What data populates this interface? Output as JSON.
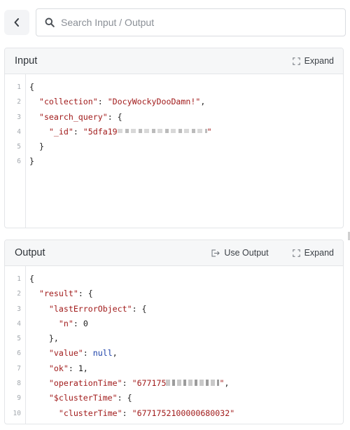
{
  "search": {
    "placeholder": "Search Input / Output"
  },
  "input_panel": {
    "title": "Input",
    "expand_label": "Expand",
    "line_numbers": [
      "1",
      "2",
      "3",
      "4",
      "5",
      "6"
    ],
    "code": {
      "collection_key": "\"collection\"",
      "collection_value": "\"DocyWockyDooDamn!\"",
      "search_query_key": "\"search_query\"",
      "id_key": "\"_id\"",
      "id_value_start": "\"5dfa19",
      "id_value_end": "\""
    }
  },
  "output_panel": {
    "title": "Output",
    "use_output_label": "Use Output",
    "expand_label": "Expand",
    "line_numbers": [
      "1",
      "2",
      "3",
      "4",
      "5",
      "6",
      "7",
      "8",
      "9",
      "10"
    ],
    "code": {
      "result_key": "\"result\"",
      "last_error_key": "\"lastErrorObject\"",
      "n_key": "\"n\"",
      "n_value": "0",
      "value_key": "\"value\"",
      "value_value": "null",
      "ok_key": "\"ok\"",
      "ok_value": "1",
      "op_time_key": "\"operationTime\"",
      "op_time_value_start": "\"677175",
      "op_time_value_end": "\"",
      "cluster_time_key": "\"$clusterTime\"",
      "cluster_time_inner_key": "\"clusterTime\"",
      "cluster_time_inner_value": "\"6771752100000680032\""
    }
  },
  "icons": {
    "back": "chevron-left-icon",
    "search": "search-icon",
    "expand": "expand-icon",
    "use_output": "use-output-icon"
  },
  "colors": {
    "key": "#a11b1b",
    "keyword": "#1a3fa8",
    "header_bg": "#f6f7f8",
    "line_number": "#a3a8ae"
  }
}
